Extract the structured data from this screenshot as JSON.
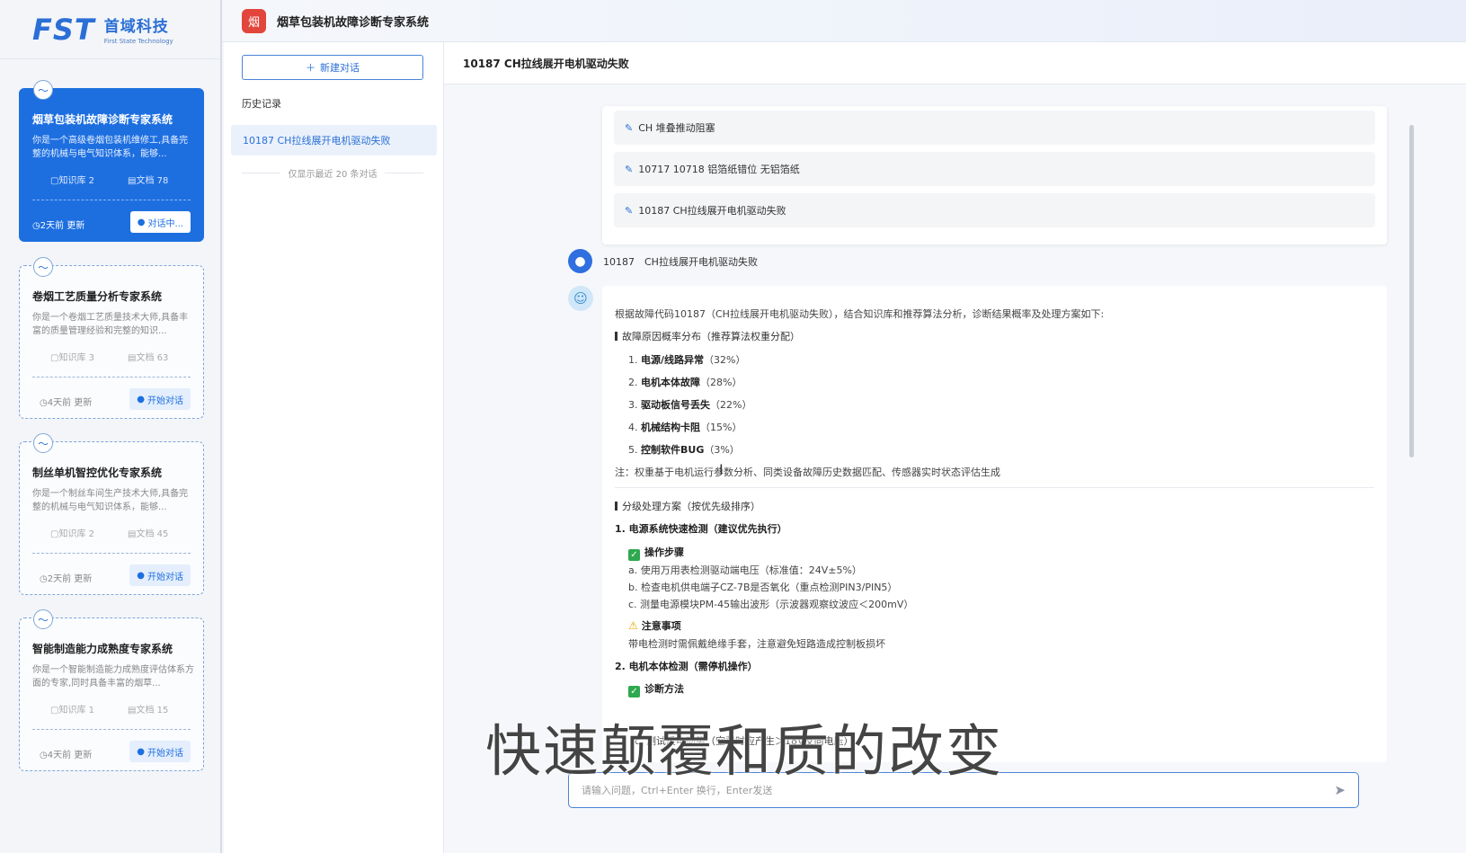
{
  "brand": {
    "mark": "FST",
    "name_cn": "首域科技",
    "name_en": "First State Technology"
  },
  "app": {
    "badge": "烟",
    "title": "烟草包装机故障诊断专家系统"
  },
  "sidebar": {
    "cards": [
      {
        "title": "烟草包装机故障诊断专家系统",
        "desc": "你是一个高级卷烟包装机维修工,具备完整的机械与电气知识体系，能够...",
        "kb": "知识库 2",
        "docs": "文档 78",
        "updated": "2天前 更新",
        "action": "对话中...",
        "active": true
      },
      {
        "title": "卷烟工艺质量分析专家系统",
        "desc": "你是一个卷烟工艺质量技术大师,具备丰富的质量管理经验和完整的知识...",
        "kb": "知识库 3",
        "docs": "文档 63",
        "updated": "4天前 更新",
        "action": "开始对话",
        "active": false
      },
      {
        "title": "制丝单机智控优化专家系统",
        "desc": "你是一个制丝车间生产技术大师,具备完整的机械与电气知识体系，能够...",
        "kb": "知识库 2",
        "docs": "文档 45",
        "updated": "2天前 更新",
        "action": "开始对话",
        "active": false
      },
      {
        "title": "智能制造能力成熟度专家系统",
        "desc": "你是一个智能制造能力成熟度评估体系方面的专家,同时具备丰富的烟草...",
        "kb": "知识库 1",
        "docs": "文档 15",
        "updated": "4天前 更新",
        "action": "开始对话",
        "active": false
      }
    ]
  },
  "history": {
    "new_button": "新建对话",
    "label": "历史记录",
    "items": [
      "10187 CH拉线展开电机驱动失败"
    ],
    "note": "仅显示最近 20 条对话"
  },
  "chat": {
    "title": "10187 CH拉线展开电机驱动失败",
    "suggestions": [
      "CH 堆叠推动阻塞",
      "10717 10718 铝箔纸错位 无铝箔纸",
      "10187 CH拉线展开电机驱动失败"
    ],
    "user_message": "10187　CH拉线展开电机驱动失败",
    "answer": {
      "intro": "根据故障代码10187（CH拉线展开电机驱动失败），结合知识库和推荐算法分析，诊断结果概率及处理方案如下:",
      "sec1": "故障原因概率分布（推荐算法权重分配）",
      "causes": [
        {
          "n": "1.",
          "name": "电源/线路异常",
          "pct": "（32%）"
        },
        {
          "n": "2.",
          "name": "电机本体故障",
          "pct": "（28%）"
        },
        {
          "n": "3.",
          "name": "驱动板信号丢失",
          "pct": "（22%）"
        },
        {
          "n": "4.",
          "name": "机械结构卡阻",
          "pct": "（15%）"
        },
        {
          "n": "5.",
          "name": "控制软件BUG",
          "pct": "（3%）"
        }
      ],
      "note": "注：权重基于电机运行参数分析、同类设备故障历史数据匹配、传感器实时状态评估生成",
      "sec2": "分级处理方案（按优先级排序）",
      "step1_title": "1. 电源系统快速检测（建议优先执行）",
      "ops_label": "操作步骤",
      "ops": [
        "a. 使用万用表检测驱动端电压（标准值：24V±5%）",
        "b. 检查电机供电端子CZ-7B是否氧化（重点检测PIN3/PIN5）",
        "c. 测量电源模块PM-45输出波形（示波器观察纹波应＜200mV）"
      ],
      "warn_label": "注意事项",
      "warn_text": "带电检测时需佩戴绝缘手套，注意避免短路造成控制板损坏",
      "step2_title": "2. 电机本体检测（需停机操作）",
      "diag_label": "诊断方法",
      "diag_line": "c. 测试反电动势（空载时应产生＞18V反向电压）"
    },
    "input_placeholder": "请输入问题，Ctrl+Enter 换行，Enter发送"
  },
  "overlay_caption": "快速颠覆和质的改变"
}
